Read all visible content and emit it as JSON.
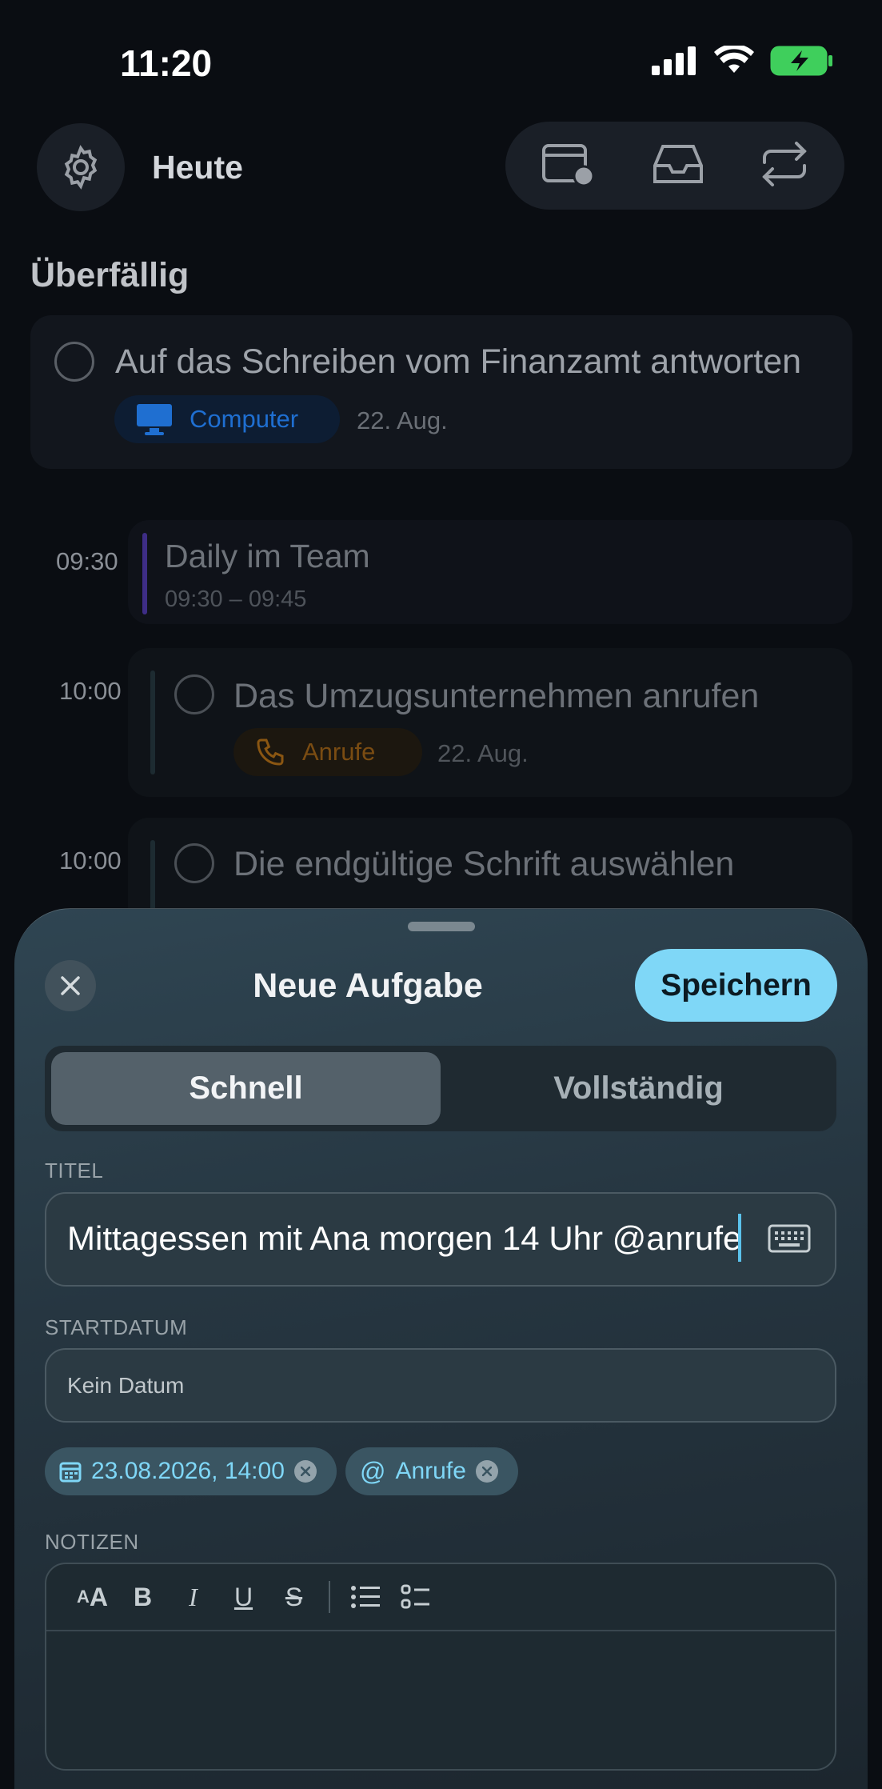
{
  "status_bar": {
    "time": "11:20"
  },
  "header": {
    "title": "Heute"
  },
  "overdue": {
    "heading": "Überfällig",
    "task": {
      "title": "Auf das Schreiben vom Finanzamt antworten",
      "tag": "Computer",
      "date": "22. Aug."
    }
  },
  "schedule": [
    {
      "time": "09:30",
      "title": "Daily im Team",
      "range": "09:30 – 09:45"
    },
    {
      "time": "10:00",
      "title": "Das Umzugsunternehmen anrufen",
      "tag": "Anrufe",
      "date": "22. Aug."
    },
    {
      "time": "10:00",
      "title": "Die endgültige Schrift auswählen"
    }
  ],
  "sheet": {
    "title": "Neue Aufgabe",
    "save_label": "Speichern",
    "tabs": {
      "quick": "Schnell",
      "full": "Vollständig"
    },
    "title_field": {
      "label": "TITEL",
      "value": "Mittagessen mit Ana morgen 14 Uhr @anrufe"
    },
    "start_field": {
      "label": "STARTDATUM",
      "placeholder": "Kein Datum"
    },
    "chips": {
      "date": "23.08.2026, 14:00",
      "context": "Anrufe"
    },
    "notes": {
      "label": "NOTIZEN"
    }
  },
  "colors": {
    "accent": "#7fd7f7",
    "computer_tag": "#1f6fd1",
    "calls_tag": "#b06a12",
    "event_bar": "#5b3fbf"
  }
}
